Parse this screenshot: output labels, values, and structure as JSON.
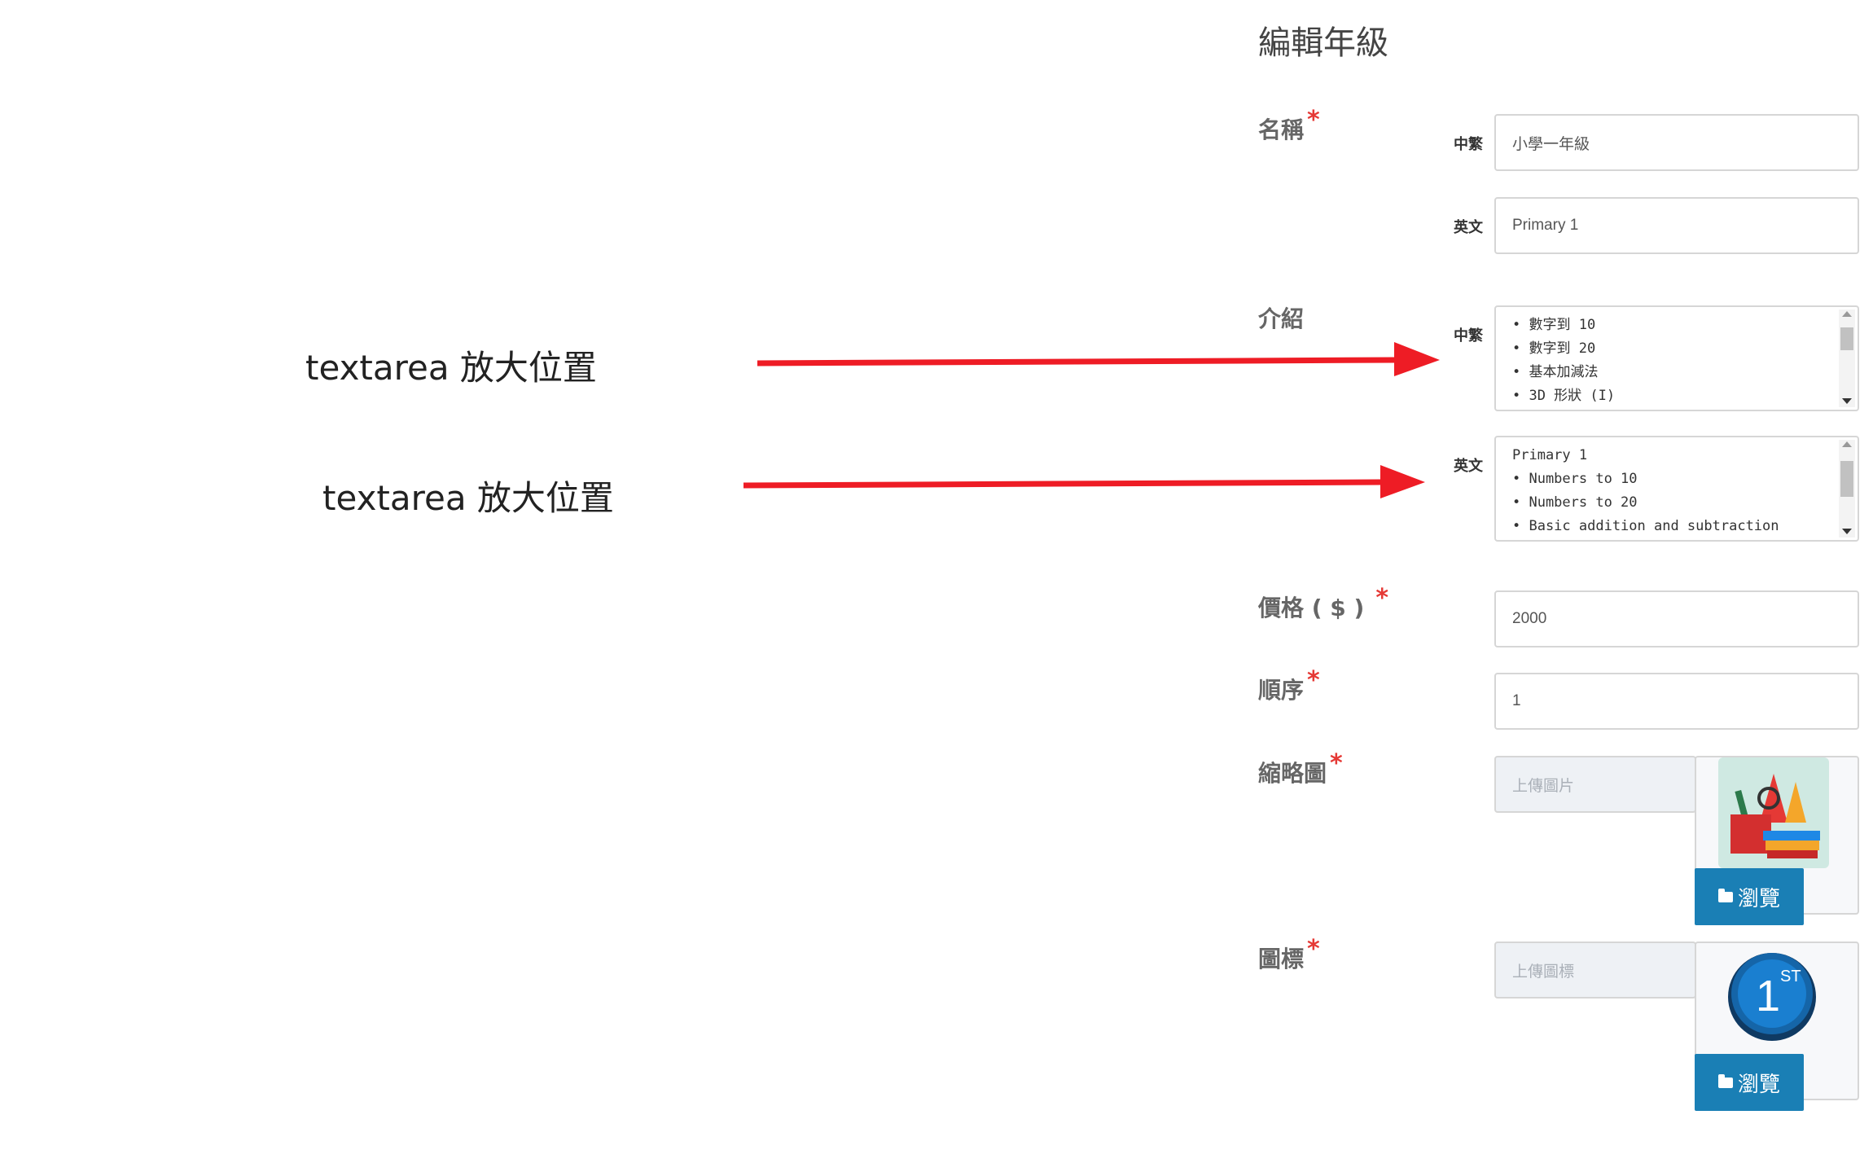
{
  "page_title": "編輯年級",
  "required_marker": "*",
  "name": {
    "label": "名稱",
    "zh_label": "中繁",
    "zh_value": "小學一年級",
    "en_label": "英文",
    "en_value": "Primary 1"
  },
  "intro": {
    "label": "介紹",
    "zh_label": "中繁",
    "zh_lines": [
      "• 數字到 10",
      "• 數字到 20",
      "• 基本加減法",
      "• 3D 形狀 (I)"
    ],
    "en_label": "英文",
    "en_lines": [
      "Primary 1",
      "• Numbers to 10",
      "• Numbers to 20",
      "• Basic addition and subtraction"
    ]
  },
  "price": {
    "label": "價格 ( $ )",
    "value": "2000"
  },
  "order": {
    "label": "順序",
    "value": "1"
  },
  "thumbnail": {
    "label": "縮略圖",
    "placeholder": "上傳圖片",
    "browse_label": "瀏覽"
  },
  "icon": {
    "label": "圖標",
    "placeholder": "上傳圖標",
    "browse_label": "瀏覽",
    "badge_number": "1",
    "badge_suffix": "ST"
  },
  "annotations": [
    "textarea 放大位置",
    "textarea 放大位置"
  ],
  "colors": {
    "arrow": "#ee1c25",
    "required": "#e53935",
    "button": "#1a7fb5",
    "badge": "#1565a8"
  }
}
